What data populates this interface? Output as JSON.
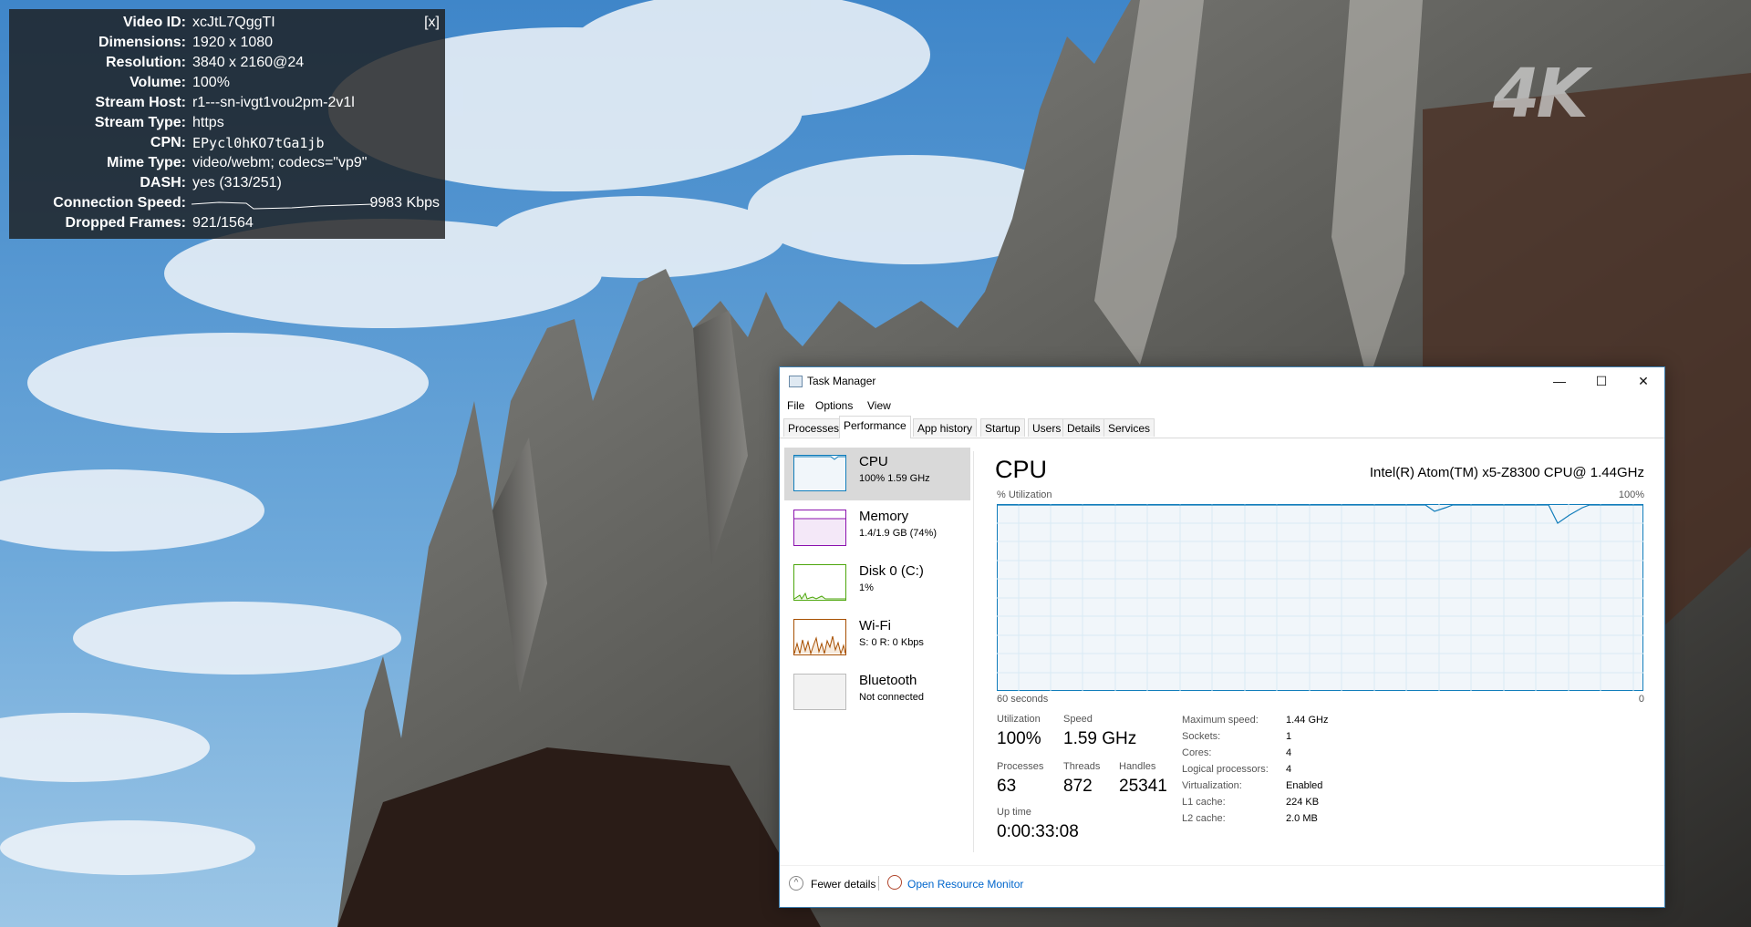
{
  "watermark": "4K",
  "stats_overlay": {
    "close": "[x]",
    "rows": [
      {
        "label": "Video ID:",
        "value": "xcJtL7QggTI"
      },
      {
        "label": "Dimensions:",
        "value": "1920 x 1080"
      },
      {
        "label": "Resolution:",
        "value": "3840 x 2160@24"
      },
      {
        "label": "Volume:",
        "value": "100%"
      },
      {
        "label": "Stream Host:",
        "value": "r1---sn-ivgt1vou2pm-2v1l"
      },
      {
        "label": "Stream Type:",
        "value": "https"
      },
      {
        "label": "CPN:",
        "value": "EPycl0hKO7tGa1jb"
      },
      {
        "label": "Mime Type:",
        "value": "video/webm; codecs=\"vp9\""
      },
      {
        "label": "DASH:",
        "value": "yes (313/251)"
      },
      {
        "label": "Connection Speed:",
        "value": "9983 Kbps"
      },
      {
        "label": "Dropped Frames:",
        "value": "921/1564"
      }
    ]
  },
  "task_manager": {
    "title": "Task Manager",
    "window_buttons": {
      "minimize": "—",
      "maximize": "☐",
      "close": "✕"
    },
    "menu": [
      "File",
      "Options",
      "View"
    ],
    "tabs": [
      "Processes",
      "Performance",
      "App history",
      "Startup",
      "Users",
      "Details",
      "Services"
    ],
    "active_tab": "Performance",
    "sidebar": [
      {
        "title": "CPU",
        "sub": "100%  1.59 GHz",
        "color": "#117dbb"
      },
      {
        "title": "Memory",
        "sub": "1.4/1.9 GB (74%)",
        "color": "#8b12ae"
      },
      {
        "title": "Disk 0 (C:)",
        "sub": "1%",
        "color": "#4da60c"
      },
      {
        "title": "Wi-Fi",
        "sub": "S: 0  R: 0 Kbps",
        "color": "#a74f01"
      },
      {
        "title": "Bluetooth",
        "sub": "Not connected",
        "color": "#bbbbbb"
      }
    ],
    "panel": {
      "title": "CPU",
      "model": "Intel(R) Atom(TM) x5-Z8300 CPU@ 1.44GHz",
      "graph_label": "% Utilization",
      "graph_max": "100%",
      "graph_time": "60 seconds",
      "graph_min": "0",
      "utilization_label": "Utilization",
      "utilization": "100%",
      "speed_label": "Speed",
      "speed": "1.59 GHz",
      "processes_label": "Processes",
      "processes": "63",
      "threads_label": "Threads",
      "threads": "872",
      "handles_label": "Handles",
      "handles": "25341",
      "uptime_label": "Up time",
      "uptime": "0:00:33:08",
      "specs": [
        {
          "label": "Maximum speed:",
          "value": "1.44 GHz"
        },
        {
          "label": "Sockets:",
          "value": "1"
        },
        {
          "label": "Cores:",
          "value": "4"
        },
        {
          "label": "Logical processors:",
          "value": "4"
        },
        {
          "label": "Virtualization:",
          "value": "Enabled"
        },
        {
          "label": "L1 cache:",
          "value": "224 KB"
        },
        {
          "label": "L2 cache:",
          "value": "2.0 MB"
        }
      ]
    },
    "footer": {
      "fewer_details": "Fewer details",
      "resource_monitor": "Open Resource Monitor"
    }
  }
}
